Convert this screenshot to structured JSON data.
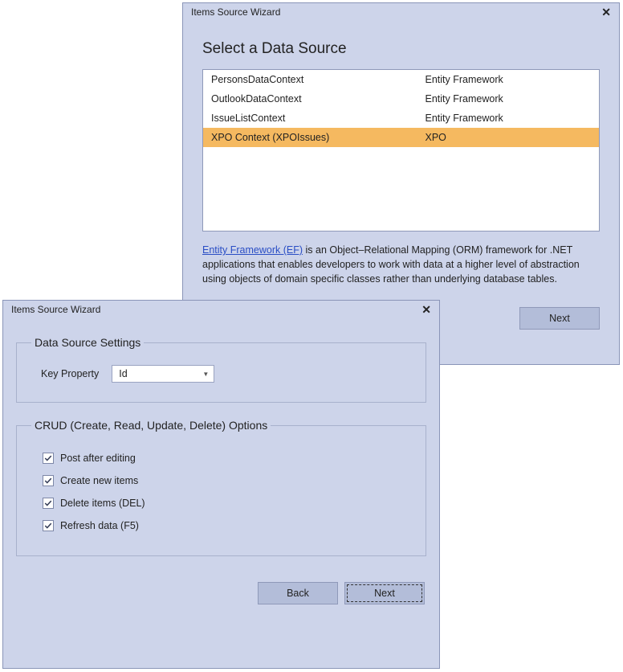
{
  "windowA": {
    "title": "Items Source Wizard",
    "heading": "Select a Data Source",
    "rows": [
      {
        "name": "PersonsDataContext",
        "tech": "Entity Framework",
        "selected": false
      },
      {
        "name": "OutlookDataContext",
        "tech": "Entity Framework",
        "selected": false
      },
      {
        "name": "IssueListContext",
        "tech": "Entity Framework",
        "selected": false
      },
      {
        "name": "XPO Context (XPOIssues)",
        "tech": "XPO",
        "selected": true
      }
    ],
    "desc_link": "Entity Framework (EF)",
    "desc_rest": " is an Object–Relational Mapping (ORM) framework for .NET applications that enables developers to work with data at a higher level of abstraction using objects of domain specific classes rather than underlying database tables.",
    "next": "Next"
  },
  "windowB": {
    "title": "Items Source Wizard",
    "group1": {
      "legend": "Data Source Settings",
      "key_label": "Key Property",
      "key_value": "Id"
    },
    "group2": {
      "legend": "CRUD (Create, Read, Update, Delete) Options",
      "options": [
        {
          "label": "Post after editing",
          "checked": true
        },
        {
          "label": "Create new items",
          "checked": true
        },
        {
          "label": "Delete items (DEL)",
          "checked": true
        },
        {
          "label": "Refresh data (F5)",
          "checked": true
        }
      ]
    },
    "back": "Back",
    "next": "Next"
  }
}
